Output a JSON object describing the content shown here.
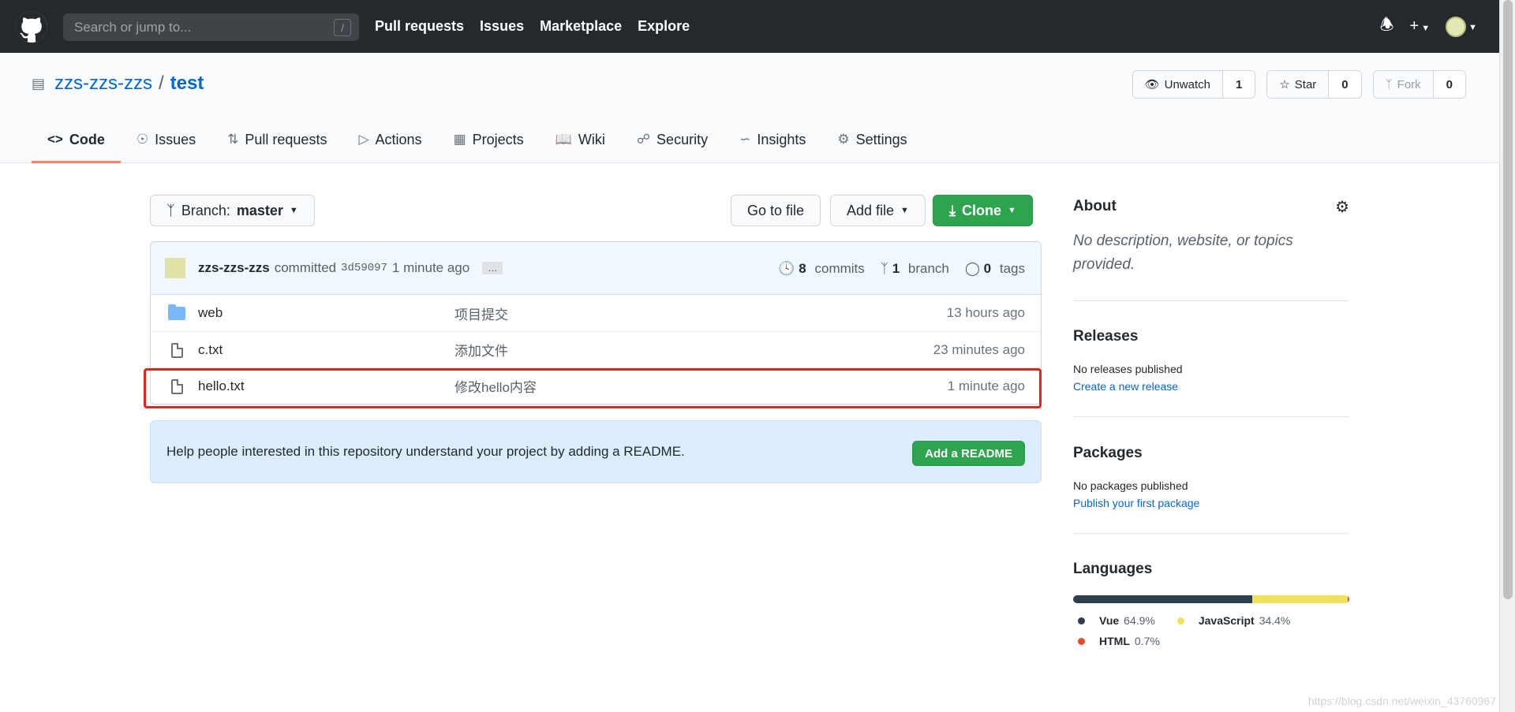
{
  "header": {
    "search_placeholder": "Search or jump to...",
    "search_shortcut": "/",
    "nav": [
      "Pull requests",
      "Issues",
      "Marketplace",
      "Explore"
    ]
  },
  "repo": {
    "owner": "zzs-zzs-zzs",
    "separator": "/",
    "name": "test",
    "watch_label": "Unwatch",
    "watch_count": "1",
    "star_label": "Star",
    "star_count": "0",
    "fork_label": "Fork",
    "fork_count": "0"
  },
  "tabs": [
    {
      "label": "Code",
      "icon": "code-icon"
    },
    {
      "label": "Issues",
      "icon": "issue-icon"
    },
    {
      "label": "Pull requests",
      "icon": "pull-request-icon"
    },
    {
      "label": "Actions",
      "icon": "play-icon"
    },
    {
      "label": "Projects",
      "icon": "project-icon"
    },
    {
      "label": "Wiki",
      "icon": "book-icon"
    },
    {
      "label": "Security",
      "icon": "shield-icon"
    },
    {
      "label": "Insights",
      "icon": "graph-icon"
    },
    {
      "label": "Settings",
      "icon": "gear-icon"
    }
  ],
  "toolbar": {
    "branch_prefix": "Branch:",
    "branch_name": "master",
    "go_to_file": "Go to file",
    "add_file": "Add file",
    "clone": "Clone"
  },
  "commit": {
    "author": "zzs-zzs-zzs",
    "verb": "committed",
    "sha": "3d59097",
    "time": "1 minute ago",
    "ellipsis": "…",
    "commits_count": "8",
    "commits_label": "commits",
    "branch_count": "1",
    "branch_label": "branch",
    "tags_count": "0",
    "tags_label": "tags"
  },
  "files": [
    {
      "type": "folder",
      "name": "web",
      "message": "项目提交",
      "age": "13 hours ago"
    },
    {
      "type": "file",
      "name": "c.txt",
      "message": "添加文件",
      "age": "23 minutes ago"
    },
    {
      "type": "file",
      "name": "hello.txt",
      "message": "修改hello内容",
      "age": "1 minute ago"
    }
  ],
  "readme_prompt": {
    "text": "Help people interested in this repository understand your project by adding a README.",
    "button": "Add a README"
  },
  "sidebar": {
    "about_title": "About",
    "about_desc": "No description, website, or topics provided.",
    "releases_title": "Releases",
    "releases_none": "No releases published",
    "releases_link": "Create a new release",
    "packages_title": "Packages",
    "packages_none": "No packages published",
    "packages_link": "Publish your first package",
    "languages_title": "Languages",
    "languages": [
      {
        "name": "Vue",
        "pct": "64.9%",
        "value": 64.9,
        "color": "#2c3e50"
      },
      {
        "name": "JavaScript",
        "pct": "34.4%",
        "value": 34.4,
        "color": "#f1e05a"
      },
      {
        "name": "HTML",
        "pct": "0.7%",
        "value": 0.7,
        "color": "#e34c26"
      }
    ]
  },
  "watermark": "https://blog.csdn.net/weixin_43760967"
}
